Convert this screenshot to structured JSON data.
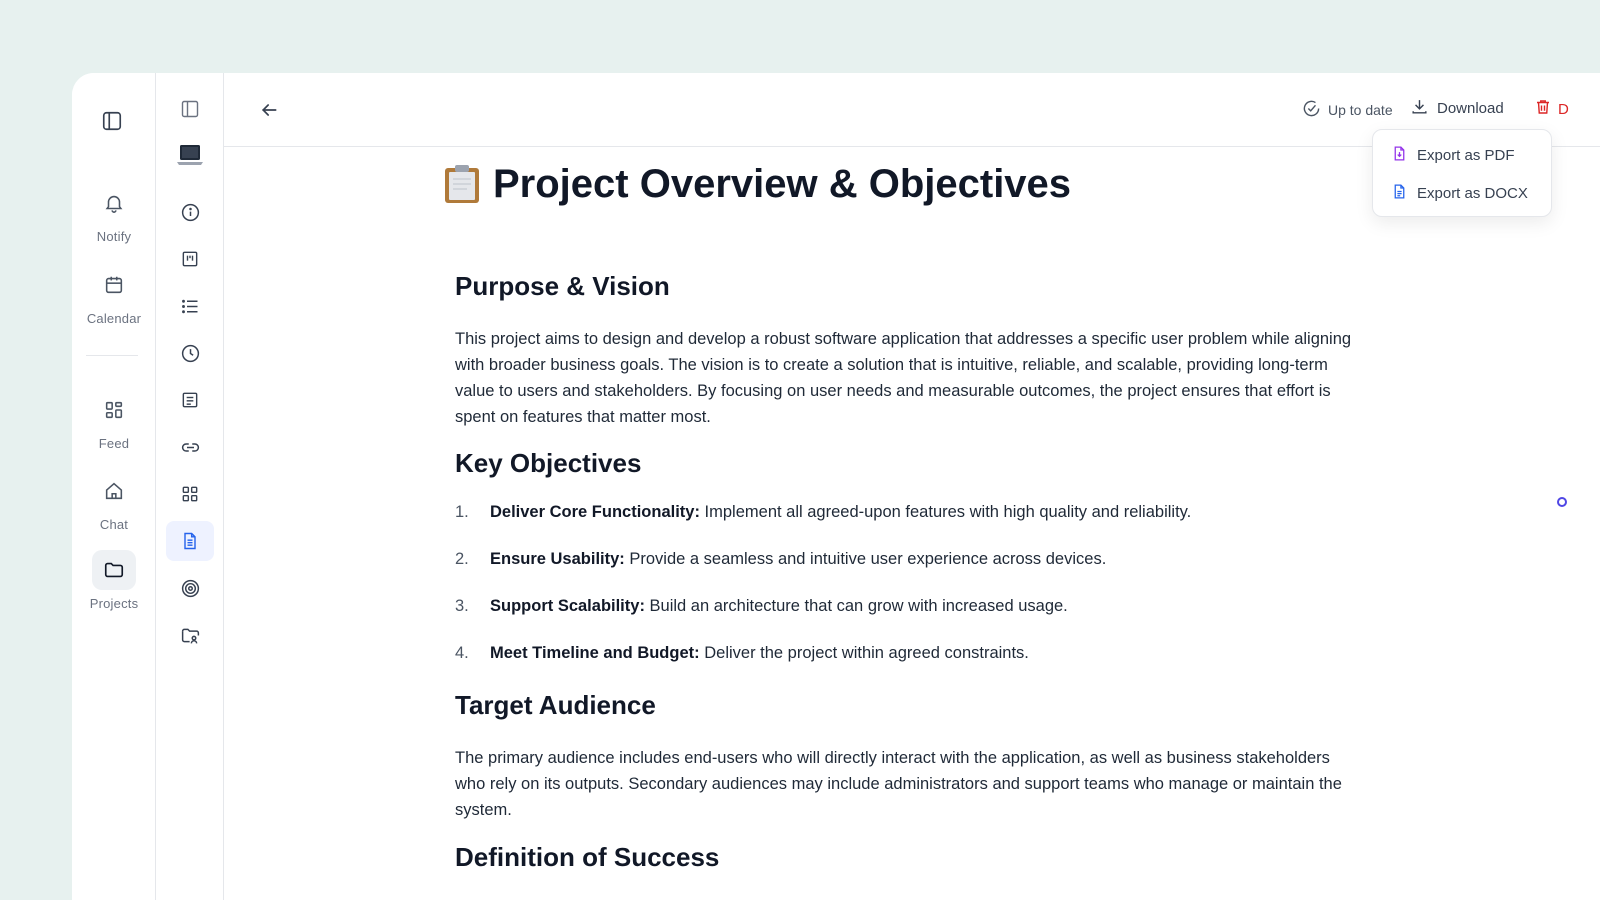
{
  "rail": {
    "items": [
      {
        "label": "Notify",
        "icon": "bell-icon"
      },
      {
        "label": "Calendar",
        "icon": "calendar-icon"
      },
      {
        "label": "Feed",
        "icon": "grid-icon"
      },
      {
        "label": "Chat",
        "icon": "home-icon"
      },
      {
        "label": "Projects",
        "icon": "folder-icon",
        "active": true
      }
    ]
  },
  "tools": {
    "items": [
      "sidebar-toggle-icon",
      "laptop-icon",
      "info-icon",
      "board-icon",
      "list-icon",
      "clock-icon",
      "notes-icon",
      "link-icon",
      "apps-grid-icon",
      "document-icon",
      "target-icon",
      "shared-folder-icon"
    ],
    "active": "document-icon"
  },
  "topbar": {
    "status_label": "Up to date",
    "download_label": "Download",
    "delete_label": "D"
  },
  "download_menu": {
    "items": [
      {
        "label": "Export as PDF",
        "icon": "pdf-file-icon"
      },
      {
        "label": "Export as DOCX",
        "icon": "docx-file-icon"
      }
    ]
  },
  "document": {
    "title_emoji": "📋",
    "title": "Project Overview & Objectives",
    "purpose_heading": "Purpose & Vision",
    "purpose_text": "This project aims to design and develop a robust software application that addresses a specific user problem while aligning with broader business goals. The vision is to create a solution that is intuitive, reliable, and scalable, providing long-term value to users and stakeholders. By focusing on user needs and measurable outcomes, the project ensures that effort is spent on features that matter most.",
    "objectives_heading": "Key Objectives",
    "objectives": [
      {
        "num": "1.",
        "term": "Deliver Core Functionality:",
        "text": " Implement all agreed-upon features with high quality and reliability."
      },
      {
        "num": "2.",
        "term": "Ensure Usability:",
        "text": " Provide a seamless and intuitive user experience across devices."
      },
      {
        "num": "3.",
        "term": "Support Scalability:",
        "text": " Build an architecture that can grow with increased usage."
      },
      {
        "num": "4.",
        "term": "Meet Timeline and Budget:",
        "text": " Deliver the project within agreed constraints."
      }
    ],
    "audience_heading": "Target Audience",
    "audience_text": "The primary audience includes end-users who will directly interact with the application, as well as business stakeholders who rely on its outputs. Secondary audiences may include administrators and support teams who manage or maintain the system.",
    "success_heading": "Definition of Success"
  },
  "colors": {
    "background": "#e7f1ef",
    "accent": "#4f46e5",
    "danger": "#dc2626",
    "pdf_icon": "#9333ea",
    "docx_icon": "#2563eb"
  }
}
